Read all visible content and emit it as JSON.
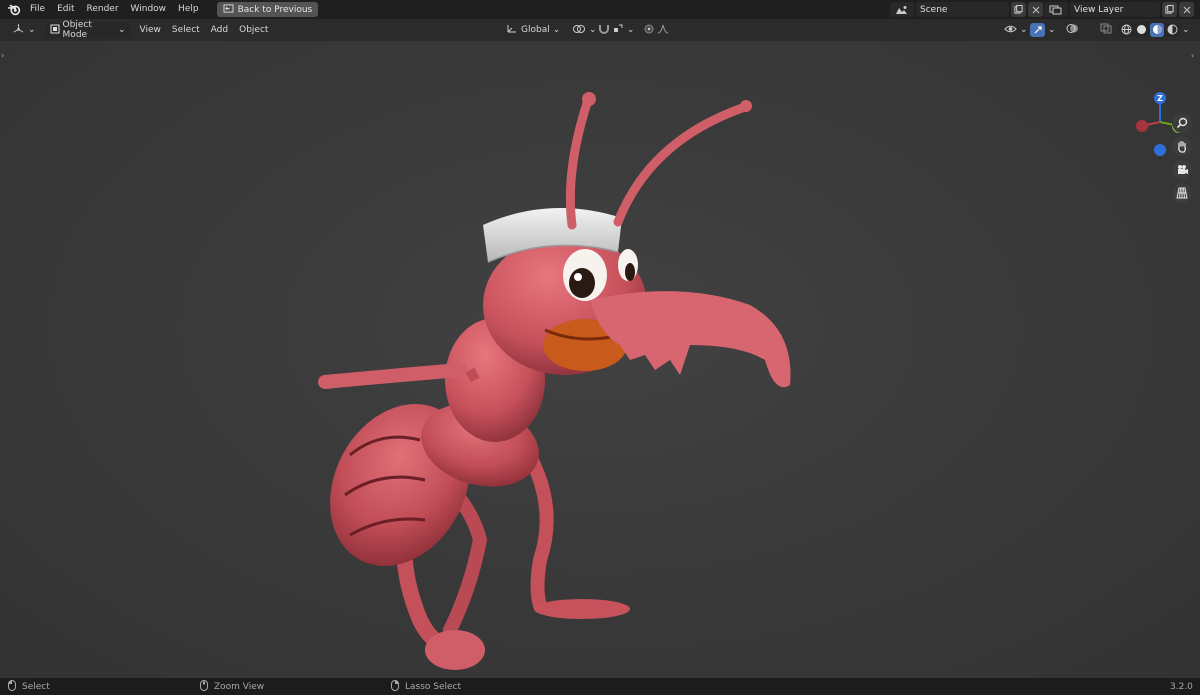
{
  "topbar": {
    "logo_icon": "blender-logo-icon",
    "menu": [
      "File",
      "Edit",
      "Render",
      "Window",
      "Help"
    ],
    "back_button": "Back to Previous",
    "scene": {
      "label": "Scene",
      "icon": "scene-icon"
    },
    "view_layer": {
      "label": "View Layer",
      "icon": "view-layer-icon"
    }
  },
  "header": {
    "editor_type_icon": "3d-viewport-icon",
    "mode": "Object Mode",
    "menus": [
      "View",
      "Select",
      "Add",
      "Object"
    ],
    "transform_orientation": "Global",
    "shading_modes": [
      "wireframe",
      "solid",
      "material-preview",
      "rendered"
    ],
    "active_shading": "material-preview"
  },
  "navigation": {
    "gizmo_axes": [
      "Z",
      "X",
      "Y"
    ],
    "buttons": [
      "zoom-icon",
      "hand-pan-icon",
      "camera-icon",
      "grid-perspective-icon"
    ]
  },
  "statusbar": {
    "items": [
      {
        "label": "Select",
        "icon": "mouse-left-icon"
      },
      {
        "label": "Zoom View",
        "icon": "mouse-middle-icon"
      },
      {
        "label": "Lasso Select",
        "icon": "mouse-right-icon"
      }
    ],
    "version": "3.2.0"
  },
  "colors": {
    "ant_body": "#c8525c",
    "ant_dark": "#a8343c",
    "ant_mouth": "#c85a1c",
    "cap": "#e8e8e8",
    "accent_blue": "#4772b3"
  }
}
